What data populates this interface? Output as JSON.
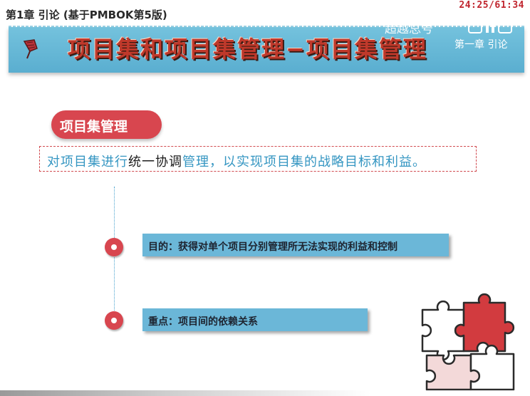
{
  "header": {
    "caption": "第1章 引论 (基于PMBOK第5版)",
    "timer": "24:25/61:34"
  },
  "banner": {
    "title": "项目集和项目集管理−项目集管理",
    "watermark": "超越总号",
    "chapter_label": "第一章 引论"
  },
  "section": {
    "pill_label": "项目集管理",
    "definition_before": "对项目集进行",
    "definition_highlight": "统一协调",
    "definition_after": "管理，以实现项目集的战略目标和利益。"
  },
  "points": [
    {
      "text": "目的：获得对单个项目分别管理所无法实现的利益和控制"
    },
    {
      "text": "重点：项目间的依赖关系"
    }
  ],
  "colors": {
    "accent_red": "#d8464f",
    "banner_blue": "#5aaed0",
    "text_blue": "#3596c2"
  },
  "icons": [
    "pushpin-icon",
    "bilibili-icon",
    "bullet-icon",
    "puzzle-icon"
  ]
}
